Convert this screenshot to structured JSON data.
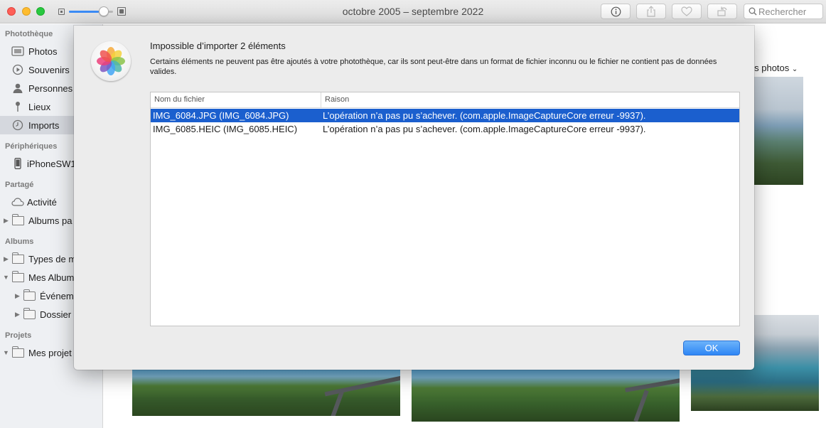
{
  "window": {
    "title": "octobre 2005 – septembre 2022"
  },
  "toolbar": {
    "search_placeholder": "Rechercher",
    "zoom_level": 0.68,
    "buttons": [
      "info-icon",
      "share-icon",
      "heart-icon",
      "rotate-icon"
    ]
  },
  "sidebar": {
    "sections": {
      "library": "Photothèque",
      "devices": "Périphériques",
      "sharing": "Partagé",
      "albums": "Albums",
      "projects": "Projets"
    },
    "items": {
      "photos": "Photos",
      "memories": "Souvenirs",
      "people": "Personnes",
      "places": "Lieux",
      "imports": "Imports",
      "iphone": "iPhoneSW1",
      "activity": "Activité",
      "shared_albums": "Albums pa",
      "media_types": "Types de m",
      "my_albums": "Mes Album",
      "events": "Événem",
      "folder": "Dossier",
      "my_projects": "Mes projet"
    }
  },
  "main": {
    "all_photos_label": "les photos"
  },
  "dialog": {
    "title": "Impossible d’importer 2 éléments",
    "message": "Certains éléments ne peuvent pas être ajoutés à votre photothèque, car ils sont peut-être dans un format de fichier inconnu ou le fichier ne contient pas de données valides.",
    "columns": [
      "Nom du fichier",
      "Raison"
    ],
    "rows": [
      {
        "file": "IMG_6084.JPG (IMG_6084.JPG)",
        "reason": "L’opération n’a pas pu s’achever. (com.apple.ImageCaptureCore erreur -9937).",
        "selected": true
      },
      {
        "file": "IMG_6085.HEIC (IMG_6085.HEIC)",
        "reason": "L’opération n’a pas pu s’achever. (com.apple.ImageCaptureCore erreur -9937).",
        "selected": false
      }
    ],
    "ok_label": "OK",
    "accent_color": "#1b5fce"
  }
}
